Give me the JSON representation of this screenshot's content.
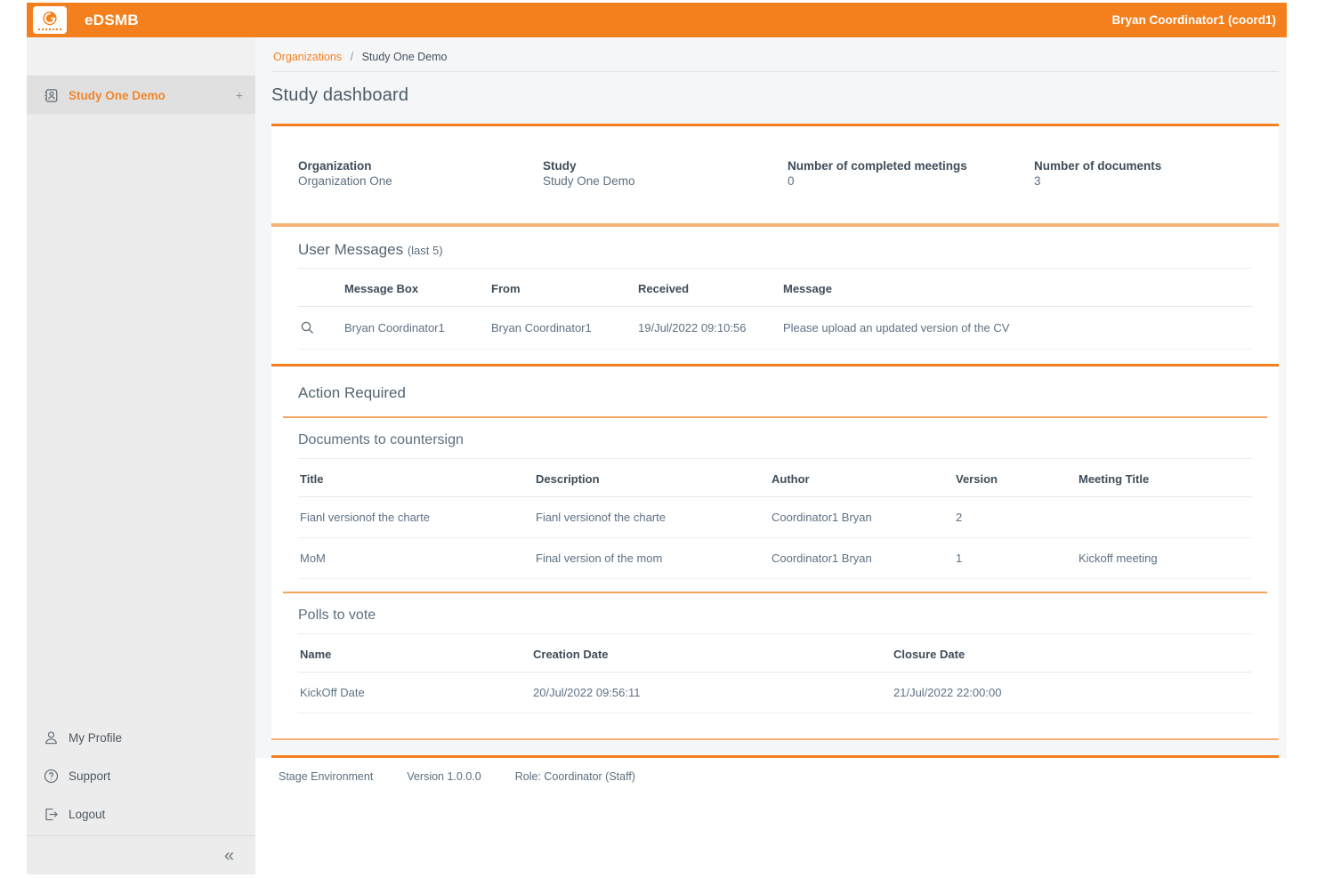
{
  "app": {
    "title": "eDSMB",
    "user": "Bryan Coordinator1 (coord1)"
  },
  "breadcrumb": {
    "link": "Organizations",
    "separator": "/",
    "current": "Study One Demo"
  },
  "sidebar": {
    "study_item": {
      "label": "Study One Demo",
      "expand_glyph": "+"
    },
    "bottom_items": [
      {
        "label": "My Profile"
      },
      {
        "label": "Support"
      },
      {
        "label": "Logout"
      }
    ],
    "collapse_glyph": "«"
  },
  "page": {
    "title": "Study dashboard"
  },
  "stats": [
    {
      "label": "Organization",
      "value": "Organization One"
    },
    {
      "label": "Study",
      "value": "Study One Demo"
    },
    {
      "label": "Number of completed meetings",
      "value": "0"
    },
    {
      "label": "Number of documents",
      "value": "3"
    }
  ],
  "user_messages": {
    "title": "User Messages",
    "note": "(last 5)",
    "columns": [
      "Message Box",
      "From",
      "Received",
      "Message"
    ],
    "rows": [
      {
        "message_box": "Bryan Coordinator1",
        "from": "Bryan Coordinator1",
        "received": "19/Jul/2022 09:10:56",
        "message": "Please upload an updated version of the CV"
      }
    ]
  },
  "action_required": {
    "title": "Action Required",
    "documents": {
      "title": "Documents to countersign",
      "columns": [
        "Title",
        "Description",
        "Author",
        "Version",
        "Meeting Title"
      ],
      "rows": [
        {
          "title": "Fianl versionof the charte",
          "description": "Fianl versionof the charte",
          "author": "Coordinator1 Bryan",
          "version": "2",
          "meeting_title": ""
        },
        {
          "title": "MoM",
          "description": "Final version of the mom",
          "author": "Coordinator1 Bryan",
          "version": "1",
          "meeting_title": "Kickoff meeting"
        }
      ]
    },
    "polls": {
      "title": "Polls to vote",
      "columns": [
        "Name",
        "Creation Date",
        "Closure Date"
      ],
      "rows": [
        {
          "name": "KickOff Date",
          "creation_date": "20/Jul/2022 09:56:11",
          "closure_date": "21/Jul/2022 22:00:00"
        }
      ]
    }
  },
  "footer": {
    "environment": "Stage Environment",
    "version": "Version 1.0.0.0",
    "role": "Role: Coordinator (Staff)"
  },
  "icons": {
    "logo": "app-logo-swirl-icon",
    "study_item": "contacts-book-icon",
    "message_row": "magnifier-icon",
    "my_profile": "person-icon",
    "support": "help-circle-icon",
    "logout": "logout-icon",
    "collapse": "double-chevron-left-icon"
  },
  "colors": {
    "brand_orange": "#f4801d",
    "light_orange": "#f6b277",
    "heading_slate": "#53646f",
    "cell_slate": "#5e7184",
    "sidebar_gray": "#ececec"
  }
}
